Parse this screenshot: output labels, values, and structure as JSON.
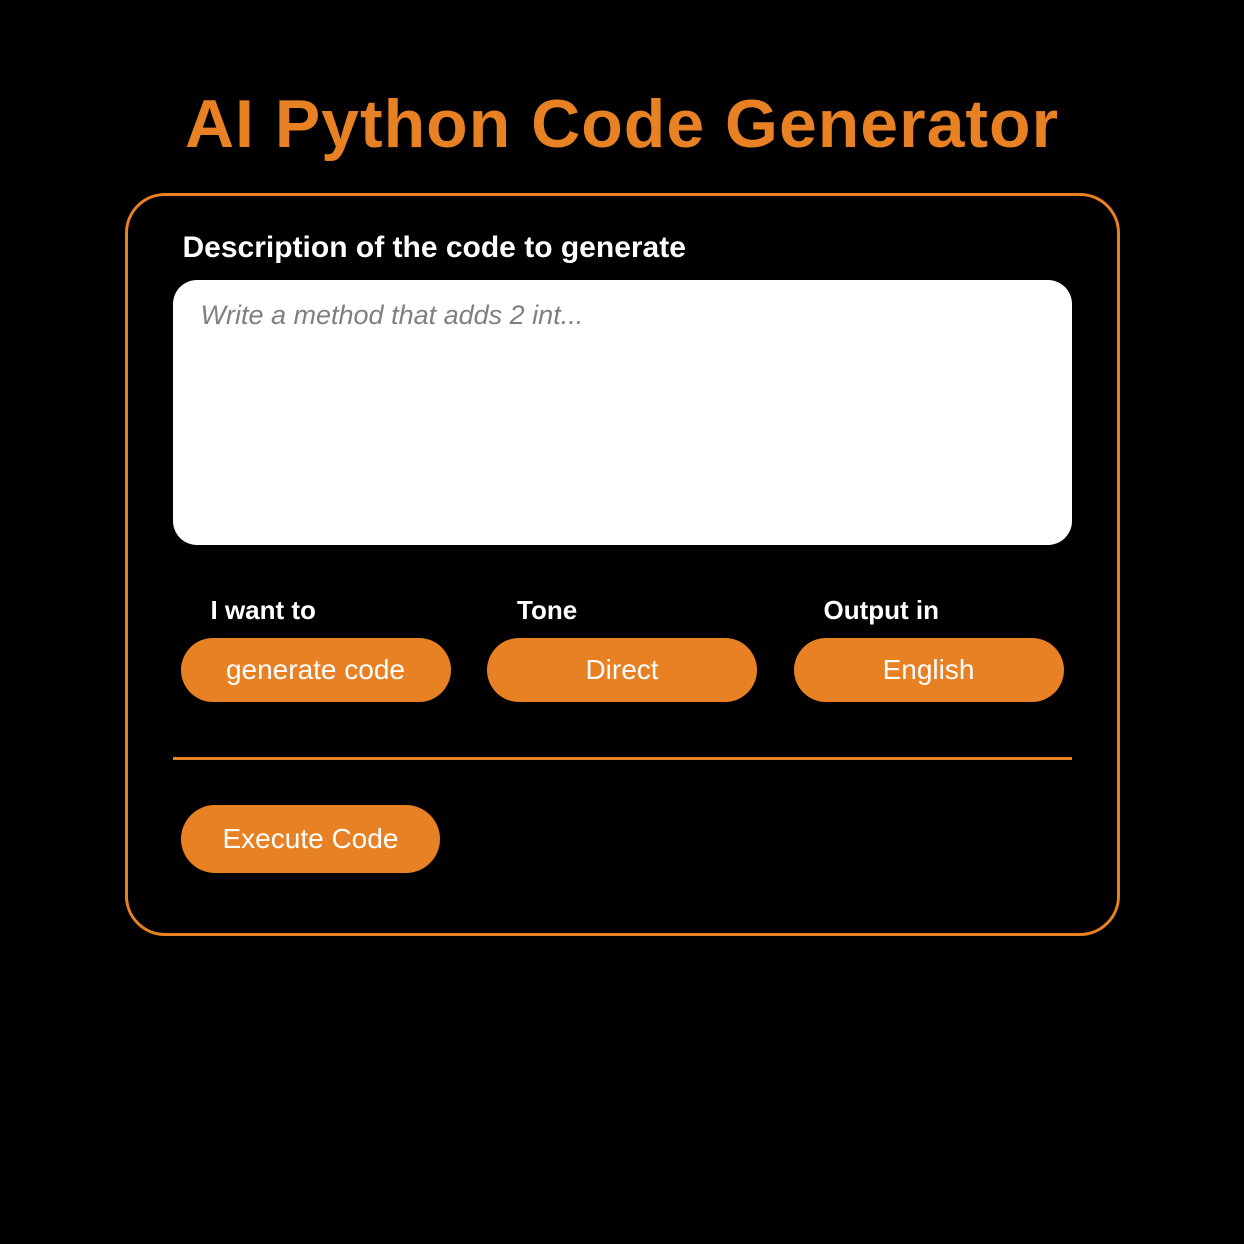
{
  "title": "AI Python Code Generator",
  "form": {
    "description_label": "Description of the code to generate",
    "description_placeholder": "Write  a method  that adds 2 int...",
    "options": {
      "iwant": {
        "label": "I want to",
        "value": "generate code"
      },
      "tone": {
        "label": "Tone",
        "value": "Direct"
      },
      "output": {
        "label": "Output in",
        "value": "English"
      }
    },
    "execute_label": "Execute Code"
  }
}
